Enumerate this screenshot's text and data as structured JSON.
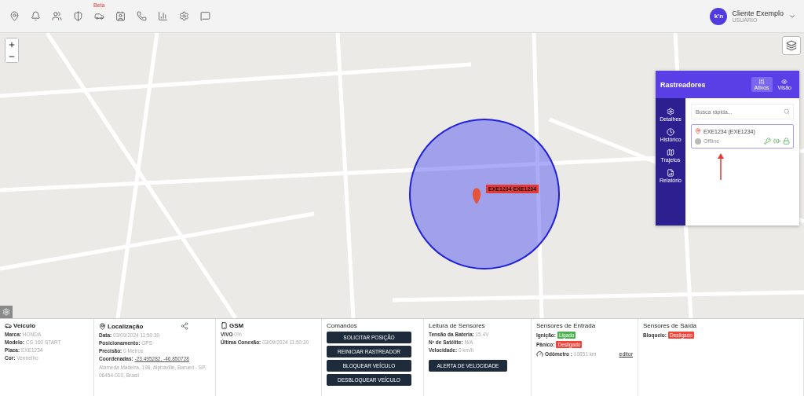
{
  "topbar": {
    "beta_badge": "Beta",
    "user": {
      "logo": "k'n",
      "name": "Cliente Exemplo",
      "role": "USUÁRIO"
    }
  },
  "map": {
    "marker_label": "EXE1234 EXE1234"
  },
  "trackers_panel": {
    "title": "Rastreadores",
    "tabs": [
      {
        "label": "Ativos",
        "selected": true
      },
      {
        "label": "Visão",
        "selected": false
      }
    ],
    "menu": [
      {
        "label": "Detalhes"
      },
      {
        "label": "Histórico"
      },
      {
        "label": "Trajetos"
      },
      {
        "label": "Relatório"
      }
    ],
    "search": {
      "placeholder": "Busca rápida..."
    },
    "items": [
      {
        "name": "EXE1234 (EXE1234)",
        "status": "Offline",
        "online": false,
        "selected": true
      }
    ]
  },
  "details": {
    "vehicle": {
      "title": "Veículo",
      "fields": [
        {
          "label": "Marca:",
          "value": "HONDA"
        },
        {
          "label": "Modelo:",
          "value": "CG 160 START"
        },
        {
          "label": "Placa:",
          "value": "EXE1234"
        },
        {
          "label": "Cor:",
          "value": "Vermelho"
        }
      ]
    },
    "location": {
      "title": "Localização",
      "fields": [
        {
          "label": "Data:",
          "value": "03/09/2024 11:50:30",
          "kind": "text"
        },
        {
          "label": "Posicionamento:",
          "value": "GPS",
          "kind": "text"
        },
        {
          "label": "Precisão:",
          "value": "0 Metros",
          "kind": "text"
        },
        {
          "label": "Coordenadas:",
          "value": "-23.495282, -46.850728",
          "kind": "link"
        }
      ],
      "address": "Alameda Madeira, 198, Alphaville, Barueri - SP, 06454-010, Brasil"
    },
    "gsm": {
      "title": "GSM",
      "fields": [
        {
          "label": "VIVO",
          "value": "0%"
        },
        {
          "label": "Última Conexão:",
          "value": "03/09/2024 11:50:30"
        }
      ]
    },
    "commands": {
      "title": "Comandos",
      "buttons": [
        "SOLICITAR POSIÇÃO",
        "REINICIAR RASTREADOR",
        "BLOQUEAR VEÍCULO",
        "DESBLOQUEAR VEÍCULO"
      ]
    },
    "sensors": {
      "title": "Leitura de Sensores",
      "fields": [
        {
          "label": "Tensão da Bateria:",
          "value": "15.4V"
        },
        {
          "label": "Nº de Satélite:",
          "value": "N/A"
        },
        {
          "label": "Velocidade:",
          "value": "0 km/h"
        }
      ],
      "button": "ALERTA DE VELOCIDADE"
    },
    "inputs": {
      "title": "Sensores de Entrada",
      "items": [
        {
          "label": "Ignição:",
          "value": "Ligado",
          "on": true
        },
        {
          "label": "Pânico:",
          "value": "Desligado",
          "on": false
        }
      ],
      "odometer": {
        "label": "Odômetro :",
        "value": "10851 km"
      },
      "edit_link": "editor"
    },
    "outputs": {
      "title": "Sensores de Saída",
      "items": [
        {
          "label": "Bloqueio:",
          "value": "Desligado",
          "on": false
        }
      ]
    }
  }
}
